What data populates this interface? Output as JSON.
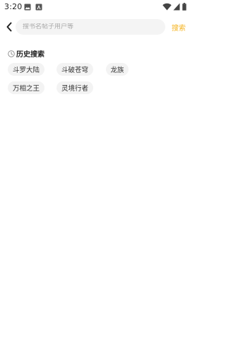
{
  "status_bar": {
    "time": "3:20"
  },
  "search": {
    "placeholder": "搜书名帖子用户等",
    "value": "",
    "button_label": "搜索",
    "accent_color": "#f5b423"
  },
  "history": {
    "title": "历史搜索",
    "tags": [
      "斗罗大陆",
      "斗破苍穹",
      "龙族",
      "万相之王",
      "灵境行者"
    ]
  }
}
